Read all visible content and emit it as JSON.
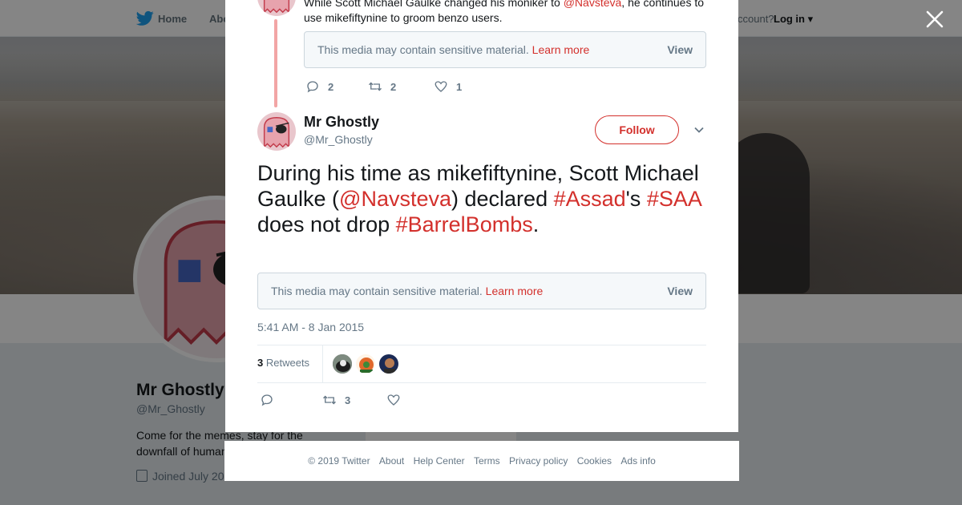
{
  "topnav": {
    "home": "Home",
    "about": "Abo",
    "account": "ccount?",
    "login": "Log in"
  },
  "profile": {
    "name": "Mr Ghostly",
    "handle": "@Mr_Ghostly",
    "bio": "Come for the memes, stay for the downfall of human",
    "joined": "Joined July 20",
    "ads": "Ads info"
  },
  "previous_tweet": {
    "text_before": "While Scott Michael Gaulke changed his moniker to ",
    "mention": "@Navsteva",
    "text_after": ", he continues to use mikefiftynine to groom benzo users.",
    "media_notice": "This media may contain sensitive material.",
    "learn_more": "Learn more",
    "view": "View",
    "reply_count": "2",
    "retweet_count": "2",
    "like_count": "1"
  },
  "tweet": {
    "name": "Mr Ghostly",
    "handle": "@Mr_Ghostly",
    "follow_label": "Follow",
    "text_1": "During his time as mikefiftynine, Scott Michael Gaulke (",
    "mention": "@Navsteva",
    "text_2": ") declared ",
    "hashtag_1": "#Assad",
    "text_3": "'s ",
    "hashtag_2": "#SAA",
    "text_4": " does not drop ",
    "hashtag_3": "#BarrelBombs",
    "text_5": ".",
    "media_notice": "This media may contain sensitive material.",
    "learn_more": "Learn more",
    "view": "View",
    "timestamp": "5:41 AM - 8 Jan 2015",
    "retweets_number": "3",
    "retweets_label": "Retweets",
    "retweet_action_count": "3"
  },
  "footer": {
    "copyright": "© 2019 Twitter",
    "links": [
      "About",
      "Help Center",
      "Terms",
      "Privacy policy",
      "Cookies",
      "Ads info"
    ]
  },
  "colors": {
    "accent": "#d3302c",
    "muted": "#657786",
    "border": "#ccd6dd"
  }
}
